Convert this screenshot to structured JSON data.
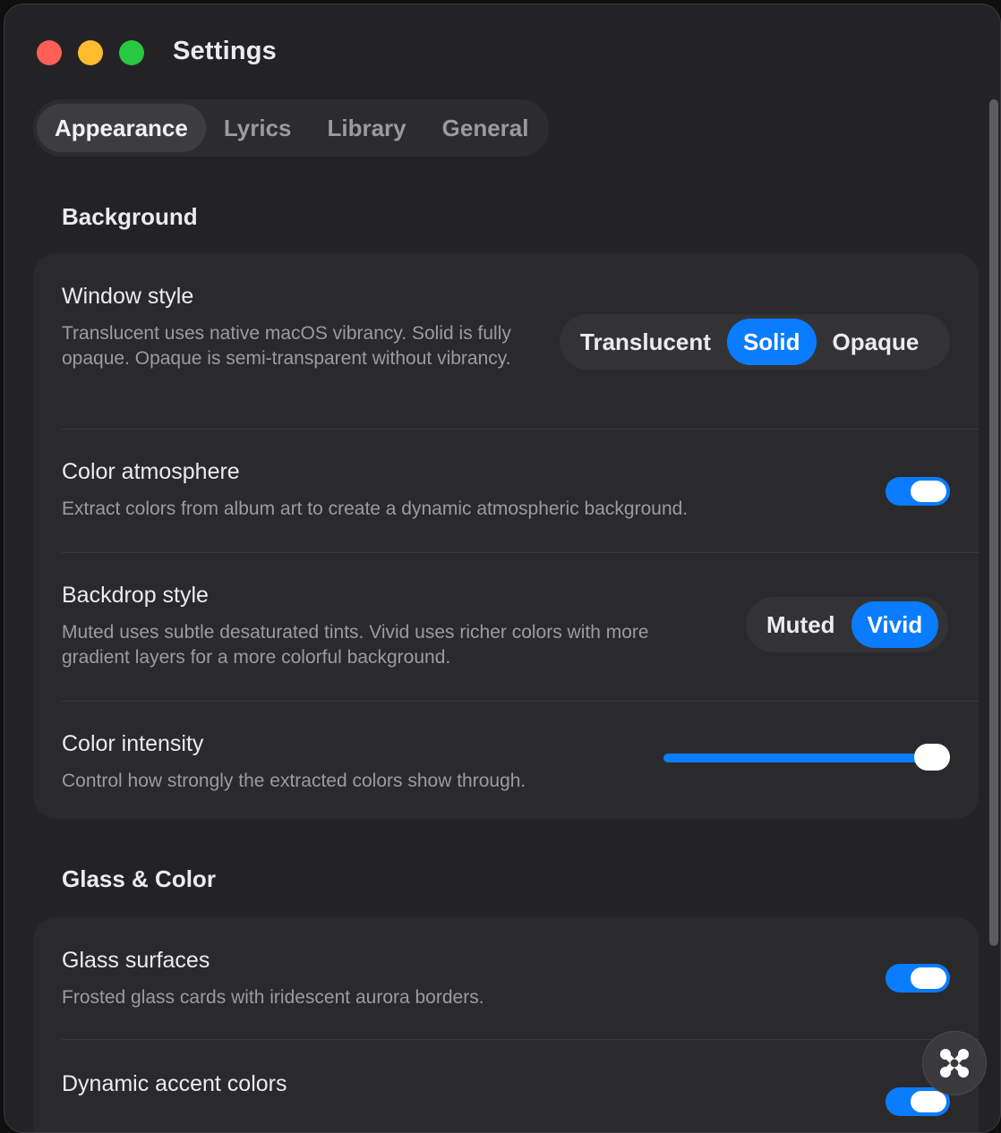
{
  "window": {
    "title": "Settings"
  },
  "tabs": [
    {
      "label": "Appearance",
      "active": true
    },
    {
      "label": "Lyrics",
      "active": false
    },
    {
      "label": "Library",
      "active": false
    },
    {
      "label": "General",
      "active": false
    }
  ],
  "sections": {
    "background": {
      "title": "Background",
      "window_style": {
        "title": "Window style",
        "desc": "Translucent uses native macOS vibrancy. Solid is fully opaque. Opaque is semi-transparent without vibrancy.",
        "options": [
          "Translucent",
          "Solid",
          "Opaque"
        ],
        "selected": "Solid"
      },
      "color_atmosphere": {
        "title": "Color atmosphere",
        "desc": "Extract colors from album art to create a dynamic atmospheric background.",
        "enabled": true
      },
      "backdrop_style": {
        "title": "Backdrop style",
        "desc": "Muted uses subtle desaturated tints. Vivid uses richer colors with more gradient layers for a more colorful background.",
        "options": [
          "Muted",
          "Vivid"
        ],
        "selected": "Vivid"
      },
      "color_intensity": {
        "title": "Color intensity",
        "desc": "Control how strongly the extracted colors show through.",
        "value": 1.0
      }
    },
    "glass_color": {
      "title": "Glass & Color",
      "glass_surfaces": {
        "title": "Glass surfaces",
        "desc": "Frosted glass cards with iridescent aurora borders.",
        "enabled": true
      },
      "dynamic_accent": {
        "title": "Dynamic accent colors",
        "enabled": true
      }
    }
  },
  "colors": {
    "accent": "#0a7cff",
    "window_bg": "#232325",
    "card_bg": "#2a2a2c"
  },
  "icons": {
    "floating_button": "close-x-icon"
  }
}
